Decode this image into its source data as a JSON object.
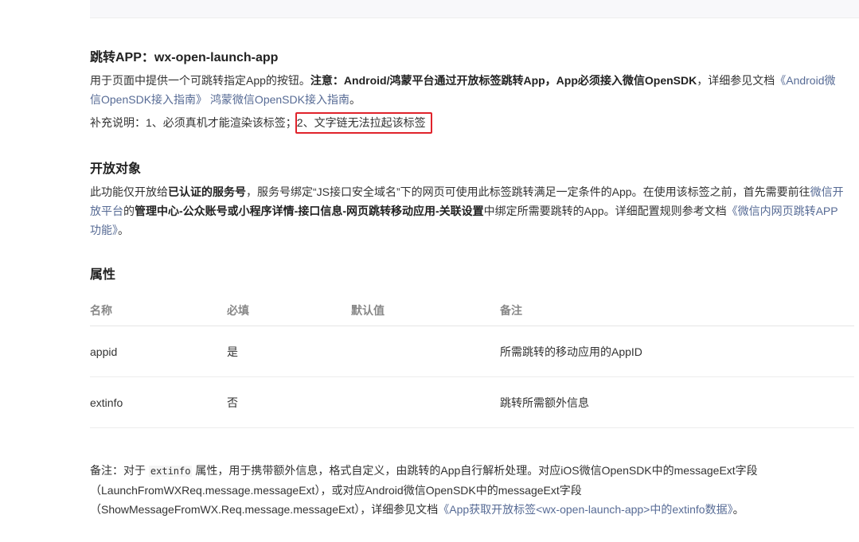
{
  "section1": {
    "title": "跳转APP：wx-open-launch-app",
    "p1_l1_a": "用于页面中提供一个可跳转指定App的按钮。",
    "p1_l1_b": "注意：Android/鸿蒙平台通过开放标签跳转App，App必须接入微信OpenSDK",
    "p1_l1_c": "，详细参见文档",
    "p1_l1_link": "《Android微",
    "p1_l2_link1": "信OpenSDK接入指南》",
    "p1_l2_link2": "鸿蒙微信OpenSDK接入指南",
    "p1_l2_end": "。",
    "p2_a": "补充说明：1、必须真机才能渲染该标签；",
    "p2_b": "2、文字链无法拉起该标签"
  },
  "section2": {
    "title": "开放对象",
    "l1_a": "此功能仅开放给",
    "l1_b": "已认证的服务号",
    "l1_c": "，服务号绑定“JS接口安全域名”下的网页可使用此标签跳转满足一定条件的App。在使用该标签之前，首先需要前往",
    "l1_link": "微信开",
    "l2_link": "放平台",
    "l2_a": "的",
    "l2_b": "管理中心-公众账号或小程序详情-接口信息-网页跳转移动应用-关联设置",
    "l2_c": "中绑定所需要跳转的App。详细配置规则参考文档",
    "l2_link2": "《微信内网页跳转APP",
    "l3_link": "功能》",
    "l3_end": "。"
  },
  "section3": {
    "title": "属性",
    "headers": [
      "名称",
      "必填",
      "默认值",
      "备注"
    ],
    "rows": [
      [
        "appid",
        "是",
        "",
        "所需跳转的移动应用的AppID"
      ],
      [
        "extinfo",
        "否",
        "",
        "跳转所需额外信息"
      ]
    ]
  },
  "note": {
    "l1_a": "备注：对于 ",
    "code": "extinfo",
    "l1_b": " 属性，用于携带额外信息，格式自定义，由跳转的App自行解析处理。对应iOS微信OpenSDK中的messageExt字段",
    "l2": "（LaunchFromWXReq.message.messageExt），或对应Android微信OpenSDK中的messageExt字段",
    "l3_a": "（ShowMessageFromWX.Req.message.messageExt），详细参见文档",
    "l3_link": "《App获取开放标签<wx-open-launch-app>中的extinfo数据》",
    "l3_end": "。"
  }
}
